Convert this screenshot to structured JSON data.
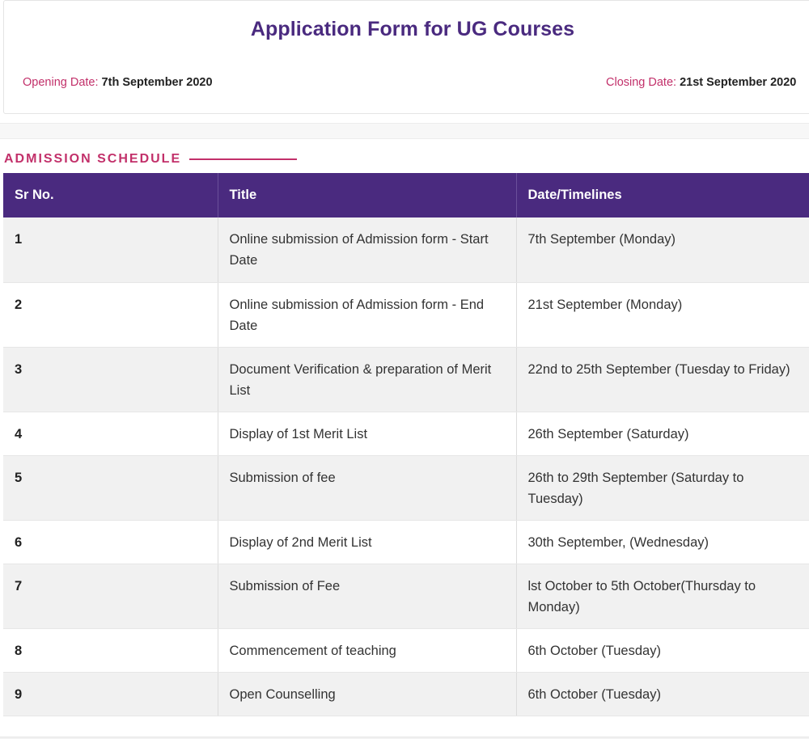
{
  "form": {
    "title": "Application Form for UG Courses",
    "opening_label": "Opening Date: ",
    "opening_value": "7th September 2020",
    "closing_label": "Closing Date: ",
    "closing_value": "21st September 2020"
  },
  "section": {
    "title": "ADMISSION SCHEDULE"
  },
  "table": {
    "headers": [
      "Sr No.",
      "Title",
      "Date/Timelines"
    ],
    "rows": [
      {
        "sr": "1",
        "title": "Online submission of Admission form - Start Date",
        "date": "7th September (Monday)"
      },
      {
        "sr": "2",
        "title": "Online submission of Admission form - End Date",
        "date": "21st September (Monday)"
      },
      {
        "sr": "3",
        "title": "Document Verification & preparation of Merit List",
        "date": "22nd to 25th September (Tuesday to Friday)"
      },
      {
        "sr": "4",
        "title": "Display of 1st Merit List",
        "date": "26th September (Saturday)"
      },
      {
        "sr": "5",
        "title": "Submission of fee",
        "date": "26th to 29th September (Saturday to Tuesday)"
      },
      {
        "sr": "6",
        "title": "Display of 2nd Merit List",
        "date": "30th September, (Wednesday)"
      },
      {
        "sr": "7",
        "title": "Submission of Fee",
        "date": "lst October to 5th October(Thursday to Monday)"
      },
      {
        "sr": "8",
        "title": "Commencement of teaching",
        "date": "6th October (Tuesday)"
      },
      {
        "sr": "9",
        "title": "Open Counselling",
        "date": "6th October (Tuesday)"
      }
    ]
  },
  "colors": {
    "header_bg": "#4a2a7f",
    "title_color": "#4a2a7f",
    "accent": "#c2306a",
    "row_alt": "#f1f1f1"
  }
}
